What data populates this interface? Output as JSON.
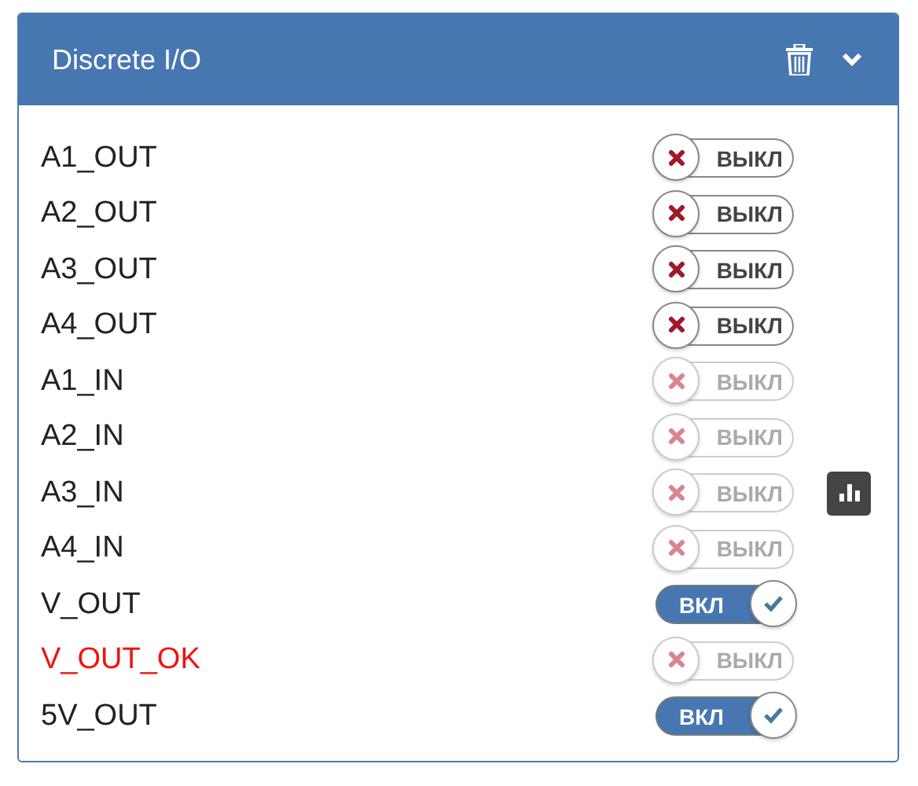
{
  "panel": {
    "title": "Discrete I/O"
  },
  "signals": [
    {
      "name": "A1_OUT",
      "on": false,
      "disabled": false,
      "error": false,
      "chart_button": false,
      "toggle_text": "ВЫКЛ"
    },
    {
      "name": "A2_OUT",
      "on": false,
      "disabled": false,
      "error": false,
      "chart_button": false,
      "toggle_text": "ВЫКЛ"
    },
    {
      "name": "A3_OUT",
      "on": false,
      "disabled": false,
      "error": false,
      "chart_button": false,
      "toggle_text": "ВЫКЛ"
    },
    {
      "name": "A4_OUT",
      "on": false,
      "disabled": false,
      "error": false,
      "chart_button": false,
      "toggle_text": "ВЫКЛ"
    },
    {
      "name": "A1_IN",
      "on": false,
      "disabled": true,
      "error": false,
      "chart_button": false,
      "toggle_text": "ВЫКЛ"
    },
    {
      "name": "A2_IN",
      "on": false,
      "disabled": true,
      "error": false,
      "chart_button": false,
      "toggle_text": "ВЫКЛ"
    },
    {
      "name": "A3_IN",
      "on": false,
      "disabled": true,
      "error": false,
      "chart_button": true,
      "toggle_text": "ВЫКЛ"
    },
    {
      "name": "A4_IN",
      "on": false,
      "disabled": true,
      "error": false,
      "chart_button": false,
      "toggle_text": "ВЫКЛ"
    },
    {
      "name": "V_OUT",
      "on": true,
      "disabled": false,
      "error": false,
      "chart_button": false,
      "toggle_text": "ВКЛ"
    },
    {
      "name": "V_OUT_OK",
      "on": false,
      "disabled": true,
      "error": true,
      "chart_button": false,
      "toggle_text": "ВЫКЛ"
    },
    {
      "name": "5V_OUT",
      "on": true,
      "disabled": false,
      "error": false,
      "chart_button": false,
      "toggle_text": "ВКЛ"
    }
  ]
}
